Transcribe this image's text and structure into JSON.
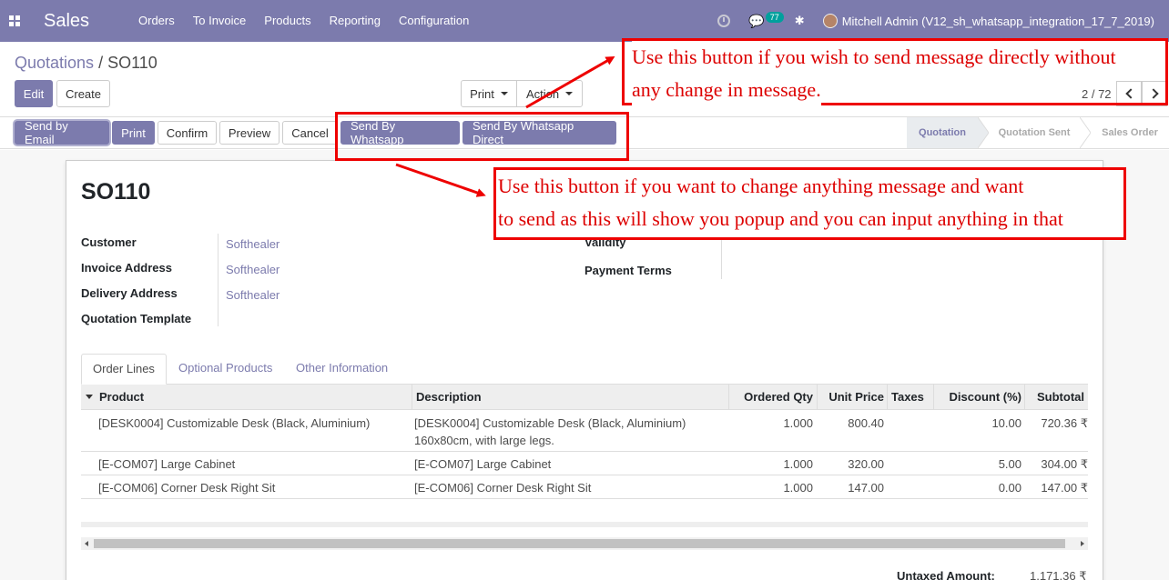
{
  "navbar": {
    "app_name": "Sales",
    "menu": [
      "Orders",
      "To Invoice",
      "Products",
      "Reporting",
      "Configuration"
    ],
    "chat_count": "77",
    "user": "Mitchell Admin (V12_sh_whatsapp_integration_17_7_2019)"
  },
  "breadcrumb": {
    "parent": "Quotations",
    "separator": " / ",
    "current": "SO110"
  },
  "buttons": {
    "edit": "Edit",
    "create": "Create",
    "print": "Print",
    "action": "Action"
  },
  "pager": {
    "value": "2 / 72"
  },
  "statusbar": {
    "send_email": "Send by Email",
    "print": "Print",
    "confirm": "Confirm",
    "preview": "Preview",
    "cancel": "Cancel",
    "send_whatsapp": "Send By Whatsapp",
    "send_whatsapp_direct": "Send By Whatsapp Direct",
    "stages": [
      "Quotation",
      "Quotation Sent",
      "Sales Order"
    ]
  },
  "form": {
    "title": "SO110",
    "customer_label": "Customer",
    "customer": "Softhealer",
    "invoice_label": "Invoice Address",
    "invoice": "Softhealer",
    "delivery_label": "Delivery Address",
    "delivery": "Softhealer",
    "template_label": "Quotation Template",
    "validity_label": "Validity",
    "payment_terms_label": "Payment Terms"
  },
  "tabs": [
    "Order Lines",
    "Optional Products",
    "Other Information"
  ],
  "table": {
    "headers": [
      "Product",
      "Description",
      "Ordered Qty",
      "Unit Price",
      "Taxes",
      "Discount (%)",
      "Subtotal"
    ],
    "rows": [
      {
        "product": "[DESK0004] Customizable Desk (Black, Aluminium)",
        "desc1": "[DESK0004] Customizable Desk (Black, Aluminium)",
        "desc2": "160x80cm, with large legs.",
        "qty": "1.000",
        "price": "800.40",
        "taxes": "",
        "discount": "10.00",
        "subtotal": "720.36 ₹"
      },
      {
        "product": "[E-COM07] Large Cabinet",
        "desc1": "[E-COM07] Large Cabinet",
        "desc2": "",
        "qty": "1.000",
        "price": "320.00",
        "taxes": "",
        "discount": "5.00",
        "subtotal": "304.00 ₹"
      },
      {
        "product": "[E-COM06] Corner Desk Right Sit",
        "desc1": "[E-COM06] Corner Desk Right Sit",
        "desc2": "",
        "qty": "1.000",
        "price": "147.00",
        "taxes": "",
        "discount": "0.00",
        "subtotal": "147.00 ₹"
      }
    ]
  },
  "totals": {
    "untaxed_label": "Untaxed Amount:",
    "untaxed_value": "1,171.36 ₹"
  },
  "annotations": {
    "top_line1": "Use this button if you wish to send message directly without",
    "top_line2": "any change in message.",
    "bottom_line1": "Use this button if you want to change anything message and want",
    "bottom_line2": "to send as this will show you popup and you can input anything in that"
  },
  "colors": {
    "brand": "#7c7bad",
    "annotation": "#e00000"
  }
}
